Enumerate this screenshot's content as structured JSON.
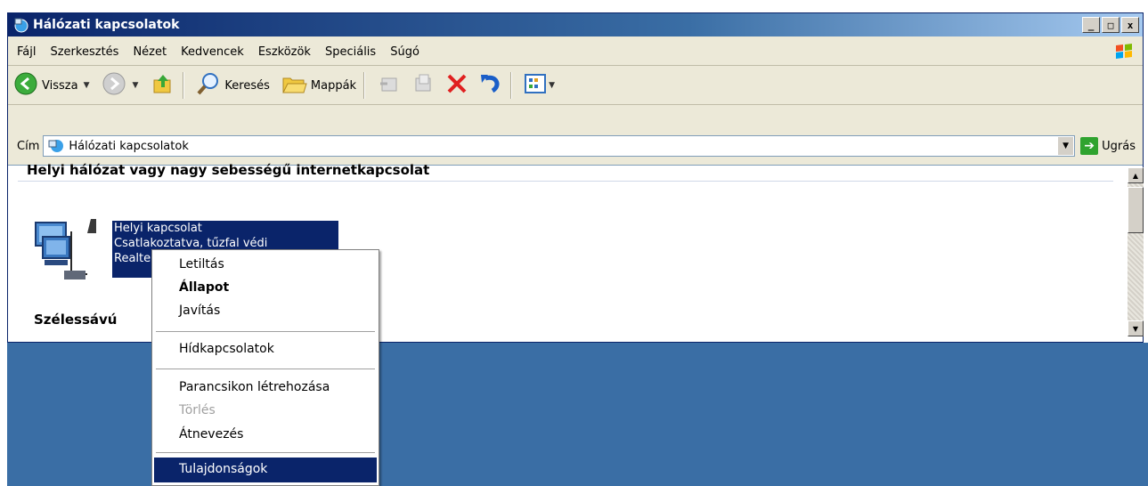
{
  "window": {
    "title": "Hálózati kapcsolatok",
    "buttons": [
      "_",
      "□",
      "x"
    ]
  },
  "menubar": {
    "items": [
      "Fájl",
      "Szerkesztés",
      "Nézet",
      "Kedvencek",
      "Eszközök",
      "Speciális",
      "Súgó"
    ]
  },
  "toolbar": {
    "back_label": "Vissza",
    "search_label": "Keresés",
    "folders_label": "Mappák"
  },
  "address": {
    "label": "Cím",
    "value": "Hálózati kapcsolatok",
    "go_label": "Ugrás"
  },
  "content": {
    "section1_title": "Helyi hálózat vagy nagy sebességű internetkapcsolat",
    "connection": {
      "line1": "Helyi kapcsolat",
      "line2": "Csatlakoztatva, tűzfal védi",
      "line3": "Realte"
    },
    "section2_title": "Szélessávú"
  },
  "context_menu": {
    "items": [
      "Letiltás",
      "Állapot",
      "Javítás",
      "Hídkapcsolatok",
      "Parancsikon létrehozása",
      "Törlés",
      "Átnevezés",
      "Tulajdonságok"
    ],
    "bold_item": "Állapot",
    "disabled_item": "Törlés",
    "highlighted_item": "Tulajdonságok"
  },
  "colors": {
    "titlebar": "#0a246a",
    "desktop": "#3a6ea5",
    "selection": "#0a246a",
    "chrome": "#ece9d8"
  }
}
